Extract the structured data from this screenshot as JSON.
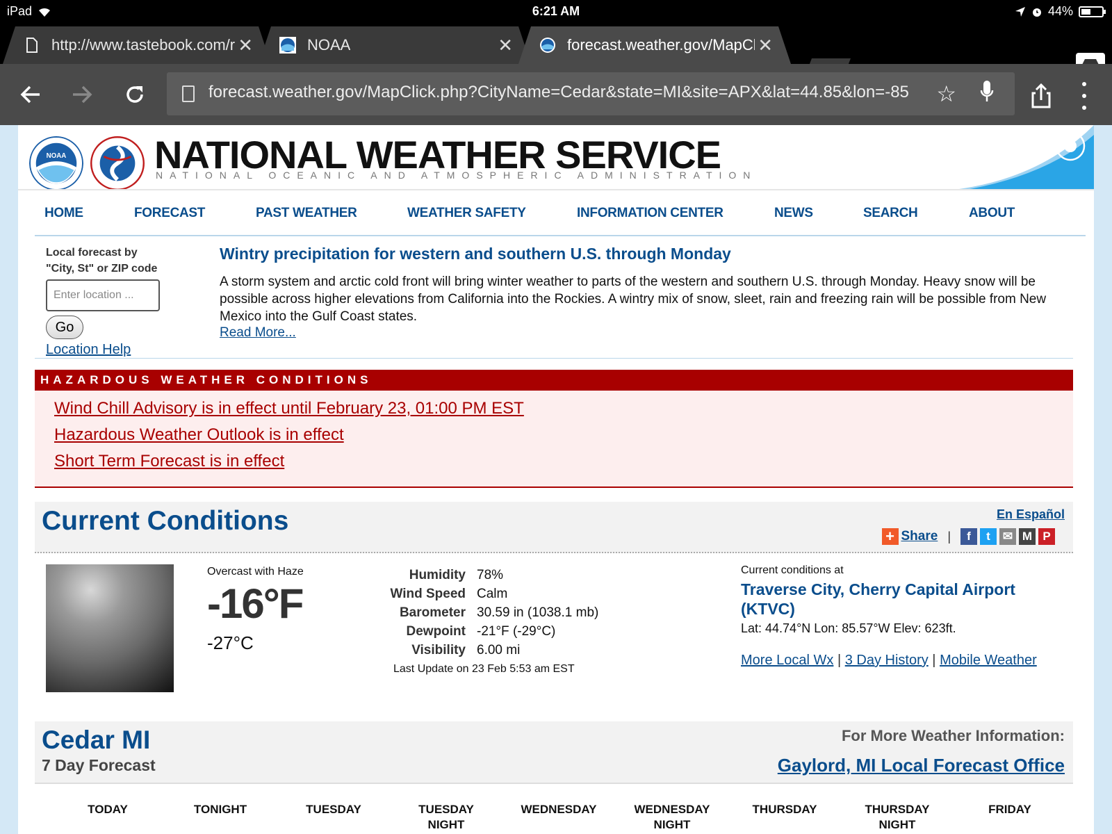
{
  "status_bar": {
    "device": "iPad",
    "time": "6:21 AM",
    "battery": "44%"
  },
  "tabs": [
    {
      "title": "http://www.tastebook.com/r",
      "icon": "page-icon"
    },
    {
      "title": "NOAA",
      "icon": "noaa-favicon"
    },
    {
      "title": "forecast.weather.gov/MapClick",
      "icon": "noaa-favicon"
    }
  ],
  "toolbar": {
    "url": "forecast.weather.gov/MapClick.php?CityName=Cedar&state=MI&site=APX&lat=44.85&lon=-85"
  },
  "masthead": {
    "title": "NATIONAL WEATHER SERVICE",
    "subtitle": "NATIONAL OCEANIC AND ATMOSPHERIC ADMINISTRATION"
  },
  "nav": [
    "HOME",
    "FORECAST",
    "PAST WEATHER",
    "WEATHER SAFETY",
    "INFORMATION CENTER",
    "NEWS",
    "SEARCH",
    "ABOUT"
  ],
  "location_search": {
    "label_line1": "Local forecast by",
    "label_line2": "\"City, St\" or ZIP code",
    "placeholder": "Enter location ...",
    "go_label": "Go",
    "help_link": "Location Help"
  },
  "headline": {
    "title": "Wintry precipitation for western and southern U.S. through Monday",
    "body": "A storm system and arctic cold front will bring winter weather to parts of the western and southern U.S. through Monday. Heavy snow will be possible across higher elevations from California into the Rockies. A wintry mix of snow, sleet, rain and freezing rain will be possible from New Mexico into the Gulf Coast states.",
    "read_more": "Read More..."
  },
  "hazards": {
    "header": "HAZARDOUS WEATHER CONDITIONS",
    "items": [
      "Wind Chill Advisory is in effect until February 23, 01:00 PM EST",
      "Hazardous Weather Outlook is in effect",
      "Short Term Forecast is in effect"
    ]
  },
  "current_conditions": {
    "title": "Current Conditions",
    "espanol": "En Español",
    "share_label": "Share",
    "description": "Overcast with Haze",
    "temp_f": "-16°F",
    "temp_c": "-27°C",
    "details": [
      {
        "label": "Humidity",
        "value": "78%"
      },
      {
        "label": "Wind Speed",
        "value": "Calm"
      },
      {
        "label": "Barometer",
        "value": "30.59 in (1038.1 mb)"
      },
      {
        "label": "Dewpoint",
        "value": "-21°F (-29°C)"
      },
      {
        "label": "Visibility",
        "value": "6.00 mi"
      }
    ],
    "last_update": "Last Update on 23 Feb 5:53 am EST",
    "station_caption": "Current conditions at",
    "station_name": "Traverse City, Cherry Capital Airport (KTVC)",
    "station_coords": "Lat: 44.74°N Lon: 85.57°W Elev: 623ft.",
    "links": [
      "More Local Wx",
      "3 Day History",
      "Mobile Weather"
    ]
  },
  "forecast": {
    "city": "Cedar MI",
    "subtitle": "7 Day Forecast",
    "more_info": "For More Weather Information:",
    "office_link": "Gaylord, MI Local Forecast Office",
    "periods": [
      {
        "line1": "TODAY",
        "line2": ""
      },
      {
        "line1": "TONIGHT",
        "line2": ""
      },
      {
        "line1": "TUESDAY",
        "line2": ""
      },
      {
        "line1": "TUESDAY",
        "line2": "NIGHT"
      },
      {
        "line1": "WEDNESDAY",
        "line2": ""
      },
      {
        "line1": "WEDNESDAY",
        "line2": "NIGHT"
      },
      {
        "line1": "THURSDAY",
        "line2": ""
      },
      {
        "line1": "THURSDAY",
        "line2": "NIGHT"
      },
      {
        "line1": "FRIDAY",
        "line2": ""
      }
    ]
  }
}
